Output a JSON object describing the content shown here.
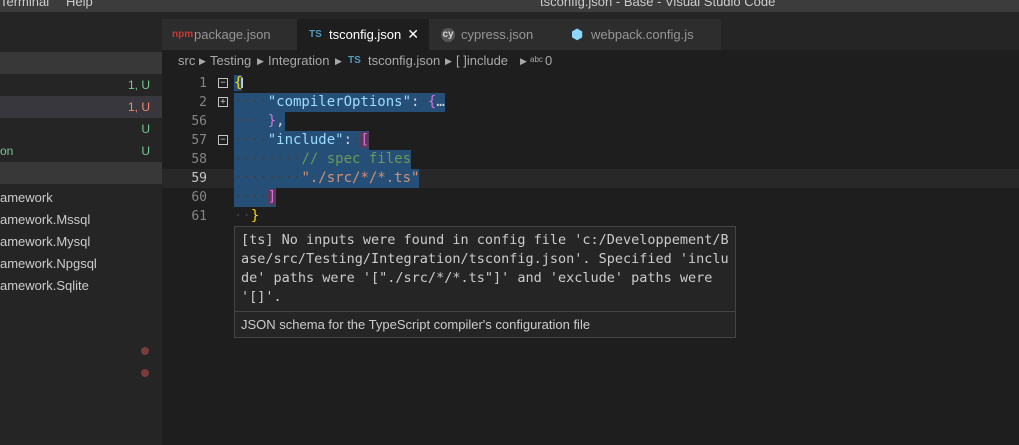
{
  "titlebar": {
    "menus": [
      "Terminal",
      "Help"
    ],
    "window_title": "tsconfig.json - Base - Visual Studio Code"
  },
  "sidebar": {
    "changes": [
      {
        "name": "",
        "status": "1, U",
        "status_color": "#73c991"
      },
      {
        "name": "",
        "status": "1, U",
        "status_color": "#f48771"
      },
      {
        "name": "",
        "status": "U",
        "status_color": "#73c991"
      },
      {
        "name": "on",
        "status": "U",
        "status_color": "#73c991"
      }
    ],
    "projects": [
      "amework",
      "amework.Mssql",
      "amework.Mysql",
      "amework.Npgsql",
      "amework.Sqlite"
    ]
  },
  "tabs": [
    {
      "label": "package.json",
      "icon": "npm-icon",
      "glyph": "npm"
    },
    {
      "label": "tsconfig.json",
      "icon": "typescript-config-icon",
      "glyph": "TS",
      "close": "✕"
    },
    {
      "label": "cypress.json",
      "icon": "cypress-icon",
      "glyph": "cy"
    },
    {
      "label": "webpack.config.js",
      "icon": "webpack-icon",
      "glyph": "⬢"
    }
  ],
  "breadcrumb": {
    "items": [
      "src",
      "Testing",
      "Integration",
      "tsconfig.json",
      "[ ]include",
      "0"
    ],
    "sep": "▶",
    "ts_glyph": "TS",
    "abc_glyph": "abc"
  },
  "editor": {
    "line_numbers": [
      "1",
      "2",
      "56",
      "57",
      "58",
      "59",
      "60",
      "61"
    ],
    "tokens": {
      "open_brace": "{",
      "compiler_options_key": "\"compilerOptions\"",
      "colon": ":",
      "obj_open": "{",
      "ellipsis": "…",
      "obj_close": "}",
      "comma": ",",
      "include_key": "\"include\"",
      "arr_open": "[",
      "comment": "// spec files",
      "string_value": "\"./src/*/*.ts\"",
      "arr_close": "]",
      "close_brace": "}"
    },
    "fold_collapsed": "+",
    "fold_expanded": "−",
    "cursor": "I"
  },
  "hover": {
    "message": "[ts] No inputs were found in config file 'c:/Developpement/Base/src/Testing/Integration/tsconfig.json'. Specified 'include' paths were '[\"./src/*/*.ts\"]' and 'exclude' paths were '[]'.",
    "description": "JSON schema for the TypeScript compiler's configuration file"
  }
}
